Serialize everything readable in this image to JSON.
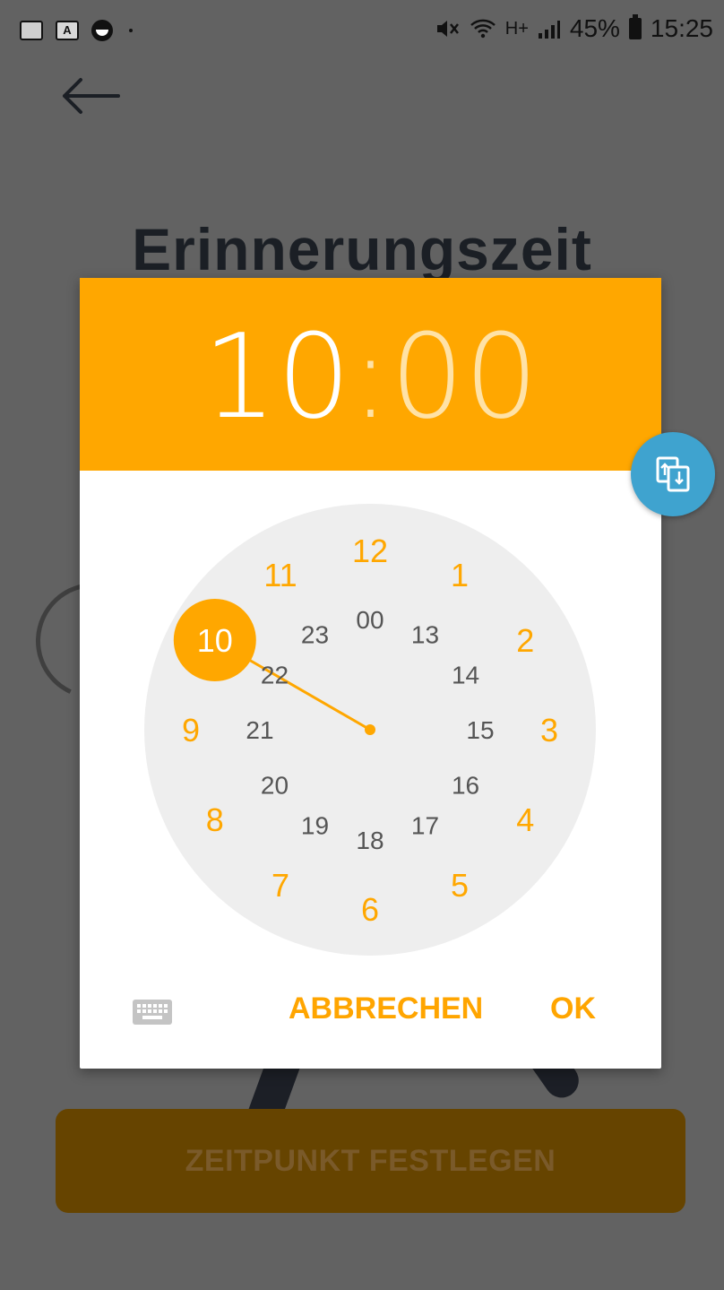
{
  "status_bar": {
    "battery": "45%",
    "time": "15:25",
    "network": "H+"
  },
  "page": {
    "title": "Erinnerungszeit",
    "cta_label": "ZEITPUNKT FESTLEGEN"
  },
  "dialog": {
    "hour": "10",
    "separator": ":",
    "minute": "00",
    "outer_hours": [
      "12",
      "1",
      "2",
      "3",
      "4",
      "5",
      "6",
      "7",
      "8",
      "9",
      "10",
      "11"
    ],
    "inner_hours": [
      "00",
      "13",
      "14",
      "15",
      "16",
      "17",
      "18",
      "19",
      "20",
      "21",
      "22",
      "23"
    ],
    "selected_hour": "10",
    "cancel_label": "ABBRECHEN",
    "ok_label": "OK"
  },
  "colors": {
    "accent": "#ffa700",
    "fab": "#3fa3cf",
    "overlay": "#626262"
  },
  "icons": [
    "back-arrow-icon",
    "keyboard-icon",
    "swap-mode-icon"
  ]
}
